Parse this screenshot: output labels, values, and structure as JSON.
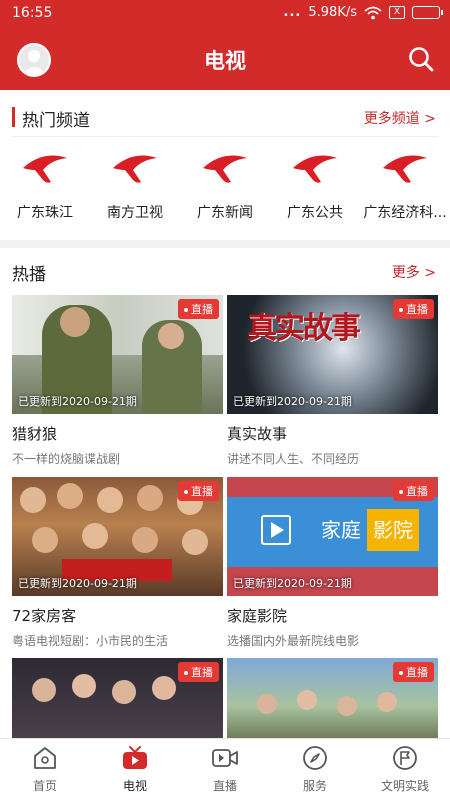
{
  "status_bar": {
    "time": "16:55",
    "dots": "...",
    "speed": "5.98K/s",
    "sim": "X"
  },
  "header": {
    "title": "电视"
  },
  "hot_channels": {
    "title": "热门频道",
    "more": "更多频道 >",
    "items": [
      {
        "name": "广东珠江"
      },
      {
        "name": "南方卫视"
      },
      {
        "name": "广东新闻"
      },
      {
        "name": "广东公共"
      },
      {
        "name": "广东经济科..."
      }
    ],
    "logo_color": "#d91e25"
  },
  "hot_shows": {
    "title": "热播",
    "more": "更多 >",
    "badge": "直播",
    "items": [
      {
        "title": "猎豺狼",
        "sub": "不一样的烧脑谍战剧",
        "update": "已更新到2020-09-21期"
      },
      {
        "title": "真实故事",
        "sub": "讲述不同人生、不同经历",
        "update": "已更新到2020-09-21期"
      },
      {
        "title": "72家房客",
        "sub": "粤语电视短剧：小市民的生活",
        "update": "已更新到2020-09-21期"
      },
      {
        "title": "家庭影院",
        "sub": "选播国内外最新院线电影",
        "update": "已更新到2020-09-21期"
      },
      {
        "badge_only": true
      },
      {
        "badge_only": true
      }
    ],
    "thumb_texts": {
      "true_story": "真实故事",
      "film_1": "家庭",
      "film_2": "影院"
    }
  },
  "bottom_nav": {
    "items": [
      {
        "label": "首页"
      },
      {
        "label": "电视"
      },
      {
        "label": "直播"
      },
      {
        "label": "服务"
      },
      {
        "label": "文明实践"
      }
    ],
    "active": "电视"
  }
}
